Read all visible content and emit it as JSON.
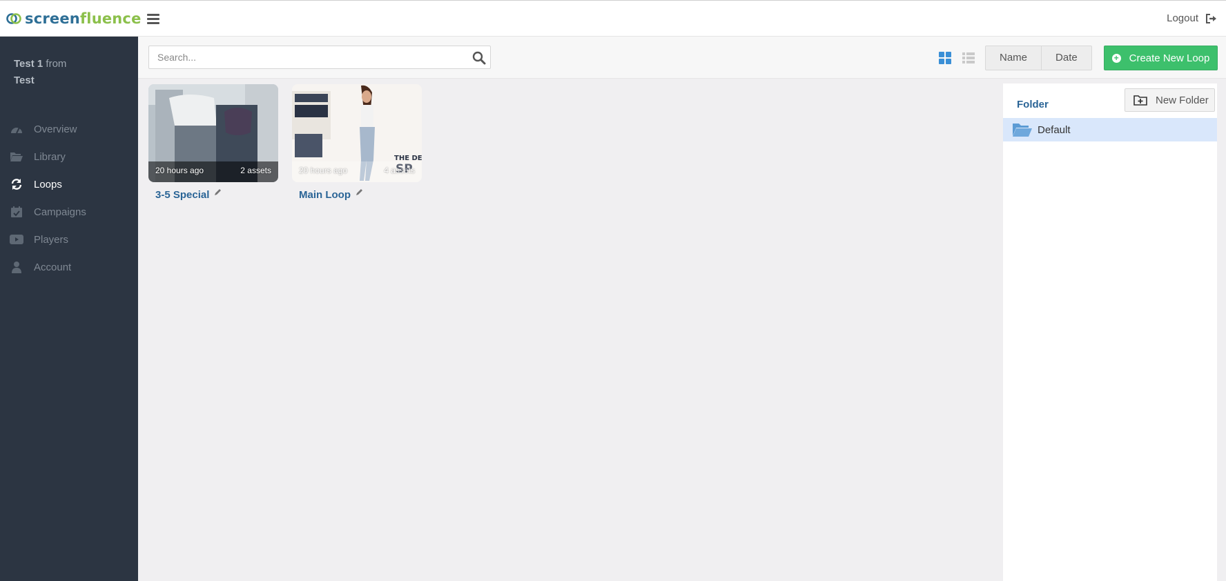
{
  "app": {
    "brand_part1": "screen",
    "brand_part2": "fluence",
    "logout_label": "Logout"
  },
  "user": {
    "name": "Test 1",
    "from_word": "from",
    "org": "Test"
  },
  "nav": {
    "items": [
      {
        "label": "Overview",
        "icon": "dashboard-icon",
        "active": false
      },
      {
        "label": "Library",
        "icon": "folder-open-icon",
        "active": false
      },
      {
        "label": "Loops",
        "icon": "refresh-icon",
        "active": true
      },
      {
        "label": "Campaigns",
        "icon": "calendar-check-icon",
        "active": false
      },
      {
        "label": "Players",
        "icon": "play-icon",
        "active": false
      },
      {
        "label": "Account",
        "icon": "user-icon",
        "active": false
      }
    ]
  },
  "toolbar": {
    "search_placeholder": "Search...",
    "sort_name": "Name",
    "sort_date": "Date",
    "create_label": "Create New Loop"
  },
  "loops": [
    {
      "title": "3-5 Special",
      "updated": "20 hours ago",
      "assets": "2 assets"
    },
    {
      "title": "Main Loop",
      "updated": "20 hours ago",
      "assets": "4 assets"
    }
  ],
  "folders": {
    "header": "Folder",
    "new_folder_label": "New Folder",
    "items": [
      {
        "name": "Default",
        "selected": true
      }
    ]
  },
  "colors": {
    "brand_blue": "#2e6f96",
    "brand_green": "#8cc04b",
    "sidebar_bg": "#2c3542",
    "create_button": "#3dc06c",
    "link": "#2a6496",
    "folder_selected_bg": "#d9e7fb"
  }
}
